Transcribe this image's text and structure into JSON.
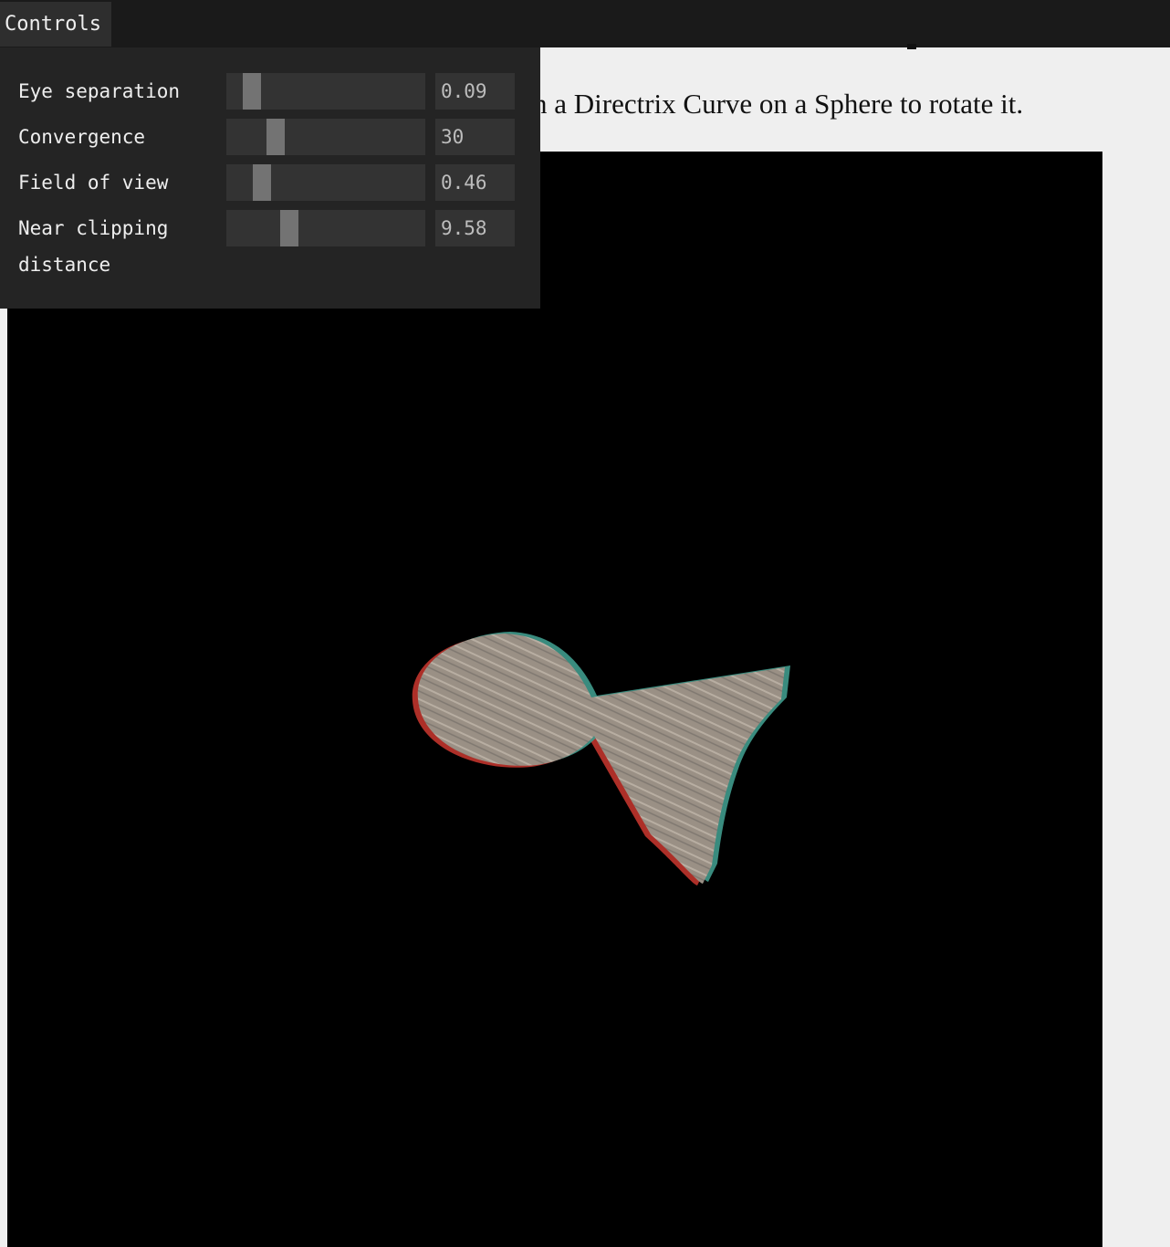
{
  "topbar": {
    "controls_label": "Controls"
  },
  "page": {
    "intro_text": "n a Directrix Curve on a Sphere to rotate it."
  },
  "controls": [
    {
      "label": "Eye separation",
      "value": "0.09",
      "level": 0.1
    },
    {
      "label": "Convergence",
      "value": "30",
      "level": 0.22
    },
    {
      "label": "Field of view",
      "value": "0.46",
      "level": 0.15
    },
    {
      "label": "Near clipping distance",
      "value": "9.58",
      "level": 0.29
    }
  ],
  "colors": {
    "panel_bg": "#242424",
    "slider_bg": "#333333",
    "slider_thumb": "#737373",
    "canvas_bg": "#000000",
    "page_bg": "#efefef",
    "anaglyph_red": "#c0342c",
    "anaglyph_cyan": "#3f9a8c",
    "surface": "#9a9085"
  },
  "icons": {
    "model": "anaglyph-3d-surface"
  }
}
